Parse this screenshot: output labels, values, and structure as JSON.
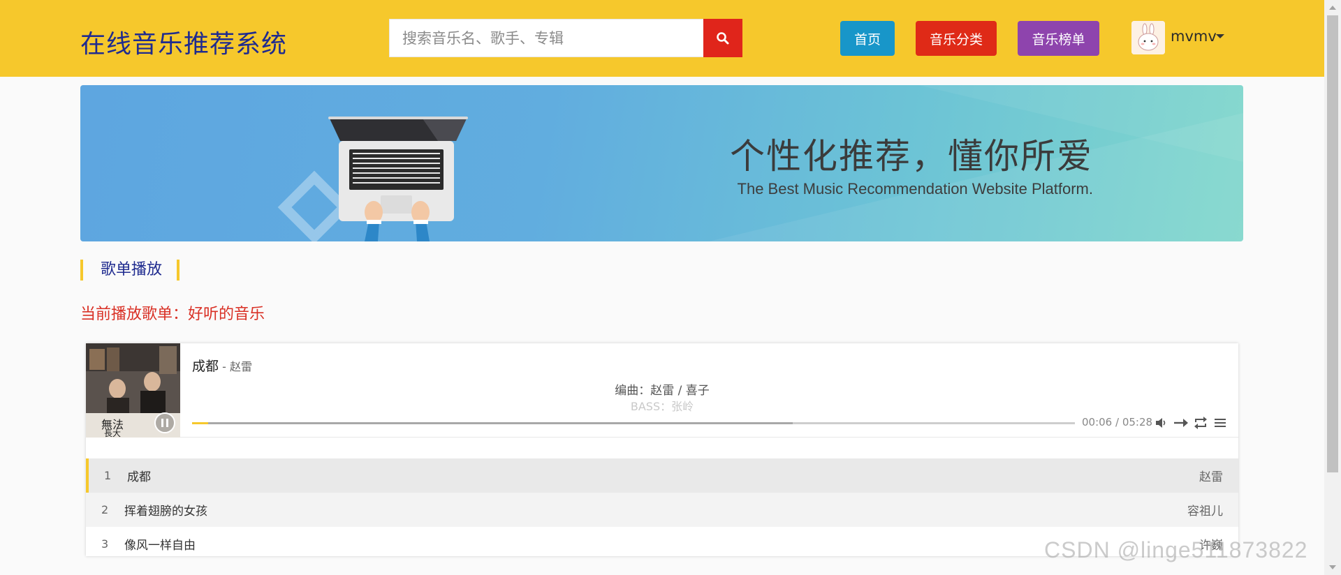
{
  "header": {
    "site_title": "在线音乐推荐系统",
    "search": {
      "placeholder": "搜索音乐名、歌手、专辑",
      "value": "",
      "icon": "search-icon"
    },
    "nav": [
      {
        "label": "首页",
        "color": "#1896c9"
      },
      {
        "label": "音乐分类",
        "color": "#df2a17"
      },
      {
        "label": "音乐榜单",
        "color": "#8e44ad"
      }
    ],
    "user": {
      "name": "mvmv",
      "icon": "chevron-down-icon"
    },
    "background": "#f6c82c"
  },
  "banner": {
    "heading": "个性化推荐，懂你所爱",
    "subheading": "The Best Music Recommendation Website Platform."
  },
  "section": {
    "title": "歌单播放",
    "now_playing_label": "当前播放歌单：",
    "now_playing_value": "好听的音乐"
  },
  "player": {
    "song_title": "成都",
    "song_artist": " - 赵雷",
    "lyric_current": "编曲：赵雷 / 喜子",
    "lyric_next": "BASS：张岭",
    "time": "00:06 / 05:28",
    "progress_played": 0.018,
    "progress_loaded": 0.68,
    "controls": [
      "volume-icon",
      "order-icon",
      "loop-icon",
      "playlist-icon"
    ],
    "playlist": [
      {
        "index": "1",
        "title": "成都",
        "artist": "赵雷"
      },
      {
        "index": "2",
        "title": "挥着翅膀的女孩",
        "artist": "容祖儿"
      },
      {
        "index": "3",
        "title": "像风一样自由",
        "artist": "许巍"
      }
    ]
  },
  "watermark": "CSDN @linge511873822"
}
